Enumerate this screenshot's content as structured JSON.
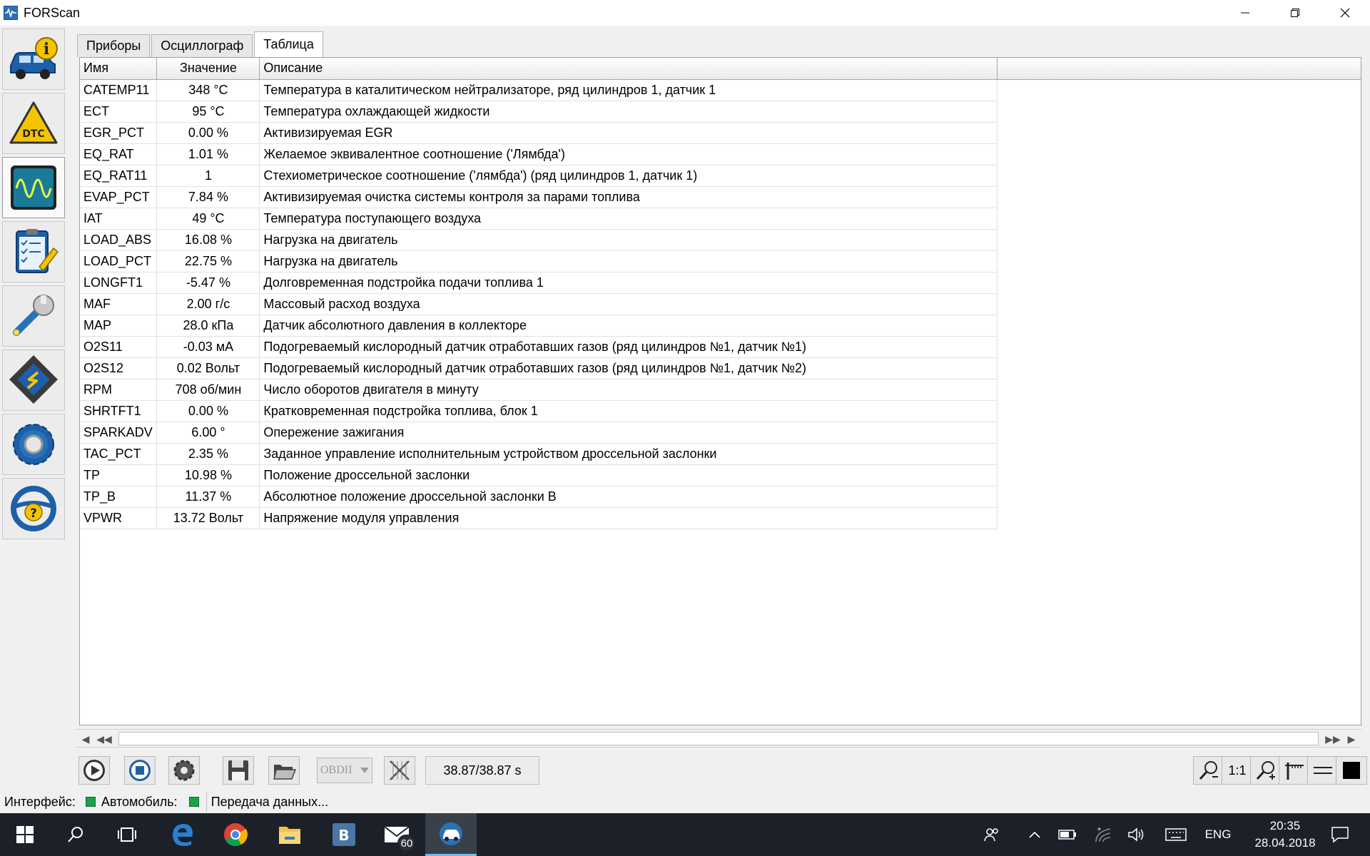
{
  "window": {
    "title": "FORScan"
  },
  "tabs": [
    {
      "label": "Приборы",
      "active": false
    },
    {
      "label": "Осциллограф",
      "active": false
    },
    {
      "label": "Таблица",
      "active": true
    }
  ],
  "table": {
    "headers": {
      "name": "Имя",
      "value": "Значение",
      "description": "Описание"
    },
    "rows": [
      {
        "name": "CATEMP11",
        "value": "348 °C",
        "description": "Температура в каталитическом нейтрализаторе, ряд цилиндров 1, датчик 1"
      },
      {
        "name": "ECT",
        "value": "95 °C",
        "description": "Температура охлаждающей жидкости"
      },
      {
        "name": "EGR_PCT",
        "value": "0.00 %",
        "description": "Активизируемая EGR"
      },
      {
        "name": "EQ_RAT",
        "value": "1.01 %",
        "description": "Желаемое эквивалентное соотношение ('Лямбда')"
      },
      {
        "name": "EQ_RAT11",
        "value": "1",
        "description": "Стехиометрическое соотношение ('лямбда') (ряд цилиндров 1, датчик 1)"
      },
      {
        "name": "EVAP_PCT",
        "value": "7.84 %",
        "description": "Активизируемая очистка системы контроля за парами топлива"
      },
      {
        "name": "IAT",
        "value": "49 °C",
        "description": "Температура поступающего воздуха"
      },
      {
        "name": "LOAD_ABS",
        "value": "16.08 %",
        "description": "Нагрузка на двигатель"
      },
      {
        "name": "LOAD_PCT",
        "value": "22.75 %",
        "description": "Нагрузка на двигатель"
      },
      {
        "name": "LONGFT1",
        "value": "-5.47 %",
        "description": "Долговременная подстройка подачи топлива 1"
      },
      {
        "name": "MAF",
        "value": "2.00 г/с",
        "description": "Массовый расход воздуха"
      },
      {
        "name": "MAP",
        "value": "28.0 кПа",
        "description": "Датчик абсолютного давления в коллекторе"
      },
      {
        "name": "O2S11",
        "value": "-0.03 мА",
        "description": "Подогреваемый кислородный датчик отработавших газов (ряд цилиндров №1, датчик №1)"
      },
      {
        "name": "O2S12",
        "value": "0.02 Вольт",
        "description": "Подогреваемый кислородный датчик отработавших газов (ряд цилиндров №1, датчик №2)"
      },
      {
        "name": "RPM",
        "value": "708 об/мин",
        "description": "Число оборотов двигателя в минуту"
      },
      {
        "name": "SHRTFT1",
        "value": "0.00 %",
        "description": "Кратковременная подстройка топлива, блок 1"
      },
      {
        "name": "SPARKADV",
        "value": "6.00 °",
        "description": "Опережение зажигания"
      },
      {
        "name": "TAC_PCT",
        "value": "2.35 %",
        "description": "Заданное управление исполнительным устройством дроссельной заслонки"
      },
      {
        "name": "TP",
        "value": "10.98 %",
        "description": "Положение дроссельной заслонки"
      },
      {
        "name": "TP_B",
        "value": "11.37 %",
        "description": "Абсолютное положение дроссельной заслонки В"
      },
      {
        "name": "VPWR",
        "value": "13.72 Вольт",
        "description": "Напряжение модуля управления"
      }
    ]
  },
  "toolbar": {
    "protocol_select": "OBDII",
    "time_readout": "38.87/38.87 s",
    "zoom_ratio": "1:1"
  },
  "statusbar": {
    "interface_label": "Интерфейс:",
    "vehicle_label": "Автомобиль:",
    "status_text": "Передача данных..."
  },
  "taskbar": {
    "mail_badge": "60",
    "language": "ENG",
    "time": "20:35",
    "date": "28.04.2018"
  },
  "colors": {
    "status_ok": "#1aa24a",
    "accent": "#2f6fb7",
    "taskbar_bg": "#1c2129"
  }
}
